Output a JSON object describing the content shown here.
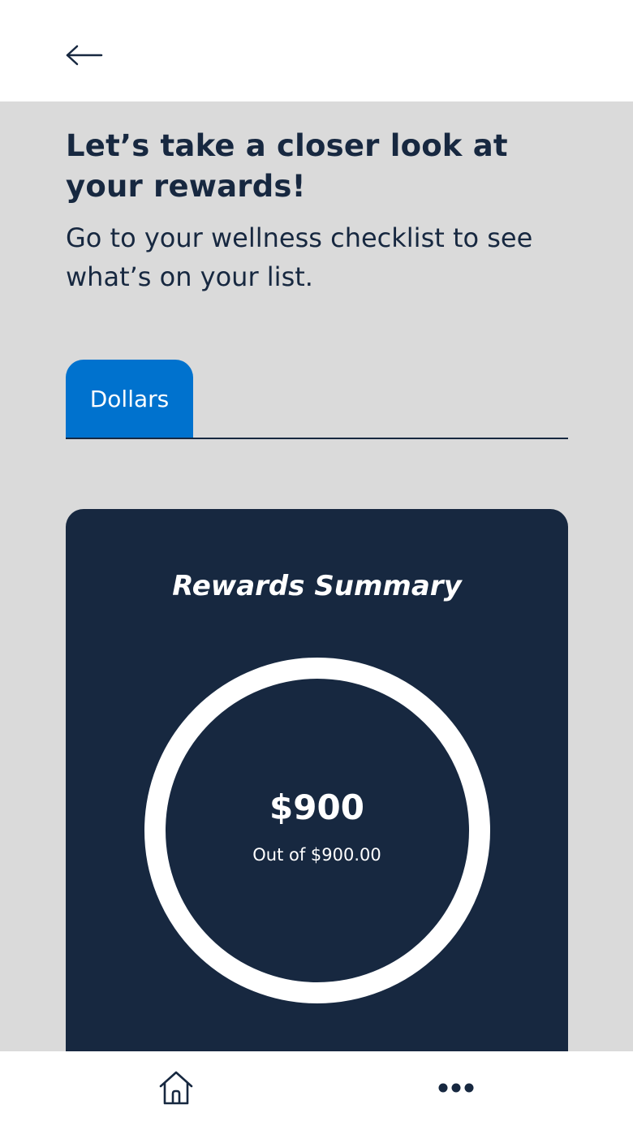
{
  "header": {
    "back_icon": "arrow-left-icon"
  },
  "intro": {
    "title": "Let’s take a closer look at your rewards!",
    "subtitle": "Go to your wellness checklist to see what’s on your list."
  },
  "tabs": [
    {
      "label": "Dollars",
      "active": true
    }
  ],
  "summary": {
    "title": "Rewards Summary",
    "earned": "$900",
    "caption": "Out of $900.00",
    "progress_fraction": 1.0
  },
  "bottom_nav": {
    "home_icon": "home-icon",
    "more_icon": "more-horizontal-icon"
  },
  "colors": {
    "navy": "#172840",
    "accent_blue": "#0072ce",
    "background": "#dadada",
    "white": "#ffffff"
  }
}
